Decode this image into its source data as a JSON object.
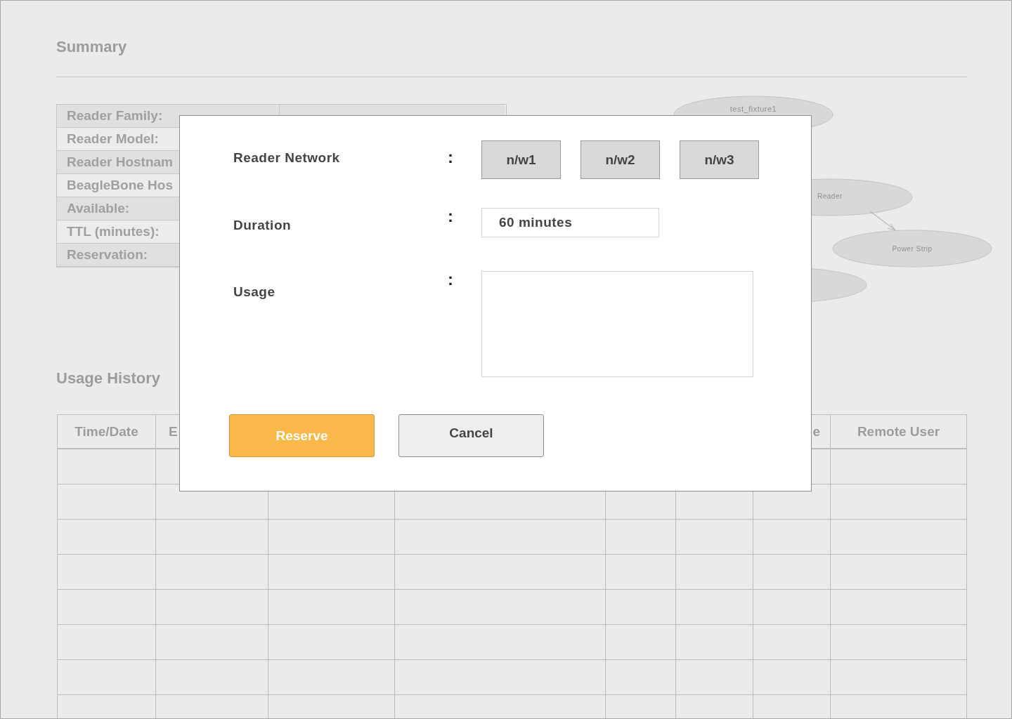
{
  "summary": {
    "title": "Summary",
    "rows": [
      {
        "label": "Reader Family:"
      },
      {
        "label": "Reader Model:"
      },
      {
        "label": "Reader Hostnam"
      },
      {
        "label": "BeagleBone Hos"
      },
      {
        "label": "Available:"
      },
      {
        "label": "TTL (minutes):"
      },
      {
        "label": "Reservation:"
      }
    ]
  },
  "diagram": {
    "nodes": [
      {
        "kind": "ellipse",
        "label": "test_fixture1"
      },
      {
        "kind": "ellipse",
        "label": "Reader"
      },
      {
        "kind": "ellipse",
        "label": "Power Strip"
      },
      {
        "kind": "ellipse"
      }
    ]
  },
  "usage_history": {
    "title": "Usage History",
    "columns": [
      {
        "label": "Time/Date"
      },
      {
        "label": "E"
      },
      {
        "label": "e"
      },
      {
        "label": "Remote User"
      }
    ]
  },
  "dialog": {
    "fields": [
      {
        "kind": "choices",
        "label": "Reader Network",
        "separator": ":",
        "options": [
          "n/w1",
          "n/w2",
          "n/w3"
        ]
      },
      {
        "kind": "input",
        "label": "Duration",
        "separator": ":",
        "value": "60 minutes"
      },
      {
        "kind": "textarea",
        "label": "Usage",
        "separator": ":"
      }
    ],
    "buttons": [
      {
        "kind": "primary",
        "label": "Reserve"
      },
      {
        "kind": "secondary",
        "label": "Cancel"
      }
    ]
  }
}
